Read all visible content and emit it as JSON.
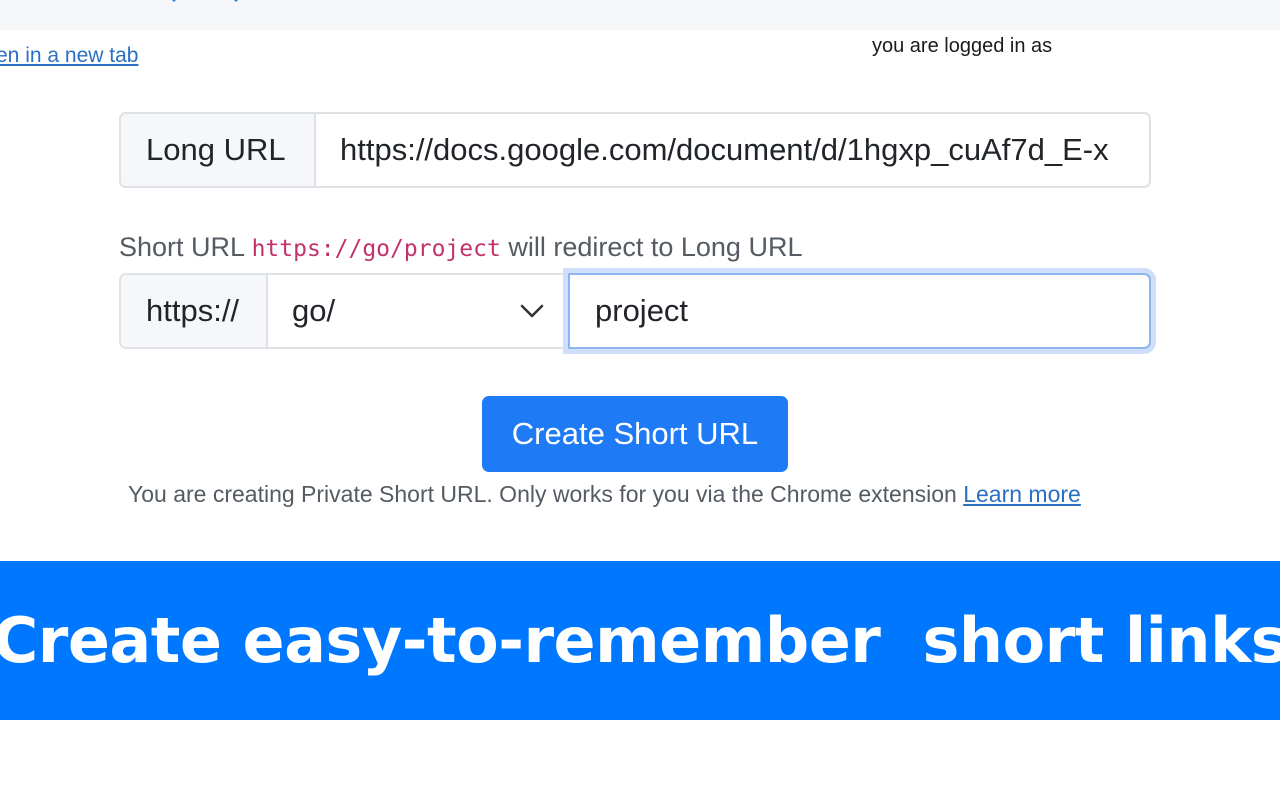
{
  "header": {
    "open_in_new_tab": "en in a new tab",
    "logged_in_text": "you are logged in as"
  },
  "long_url": {
    "label": "Long URL",
    "value": "https://docs.google.com/document/d/1hgxp_cuAf7d_E-x"
  },
  "hint": {
    "prefix": "Short URL",
    "short_url": "https://go/project",
    "suffix": "will redirect to Long URL"
  },
  "short_url": {
    "scheme": "https://",
    "domain_selected": "go/",
    "slug": "project"
  },
  "create_button": {
    "label": "Create Short URL"
  },
  "note": {
    "text": "You are creating Private Short URL. Only works for you via the Chrome extension",
    "learn_more": "Learn more"
  },
  "banner": {
    "text": "Create easy-to-remember  short links"
  },
  "colors": {
    "accent": "#1f7af5",
    "banner": "#0077ff",
    "link": "#2a6fc4",
    "code": "#c2326b"
  }
}
